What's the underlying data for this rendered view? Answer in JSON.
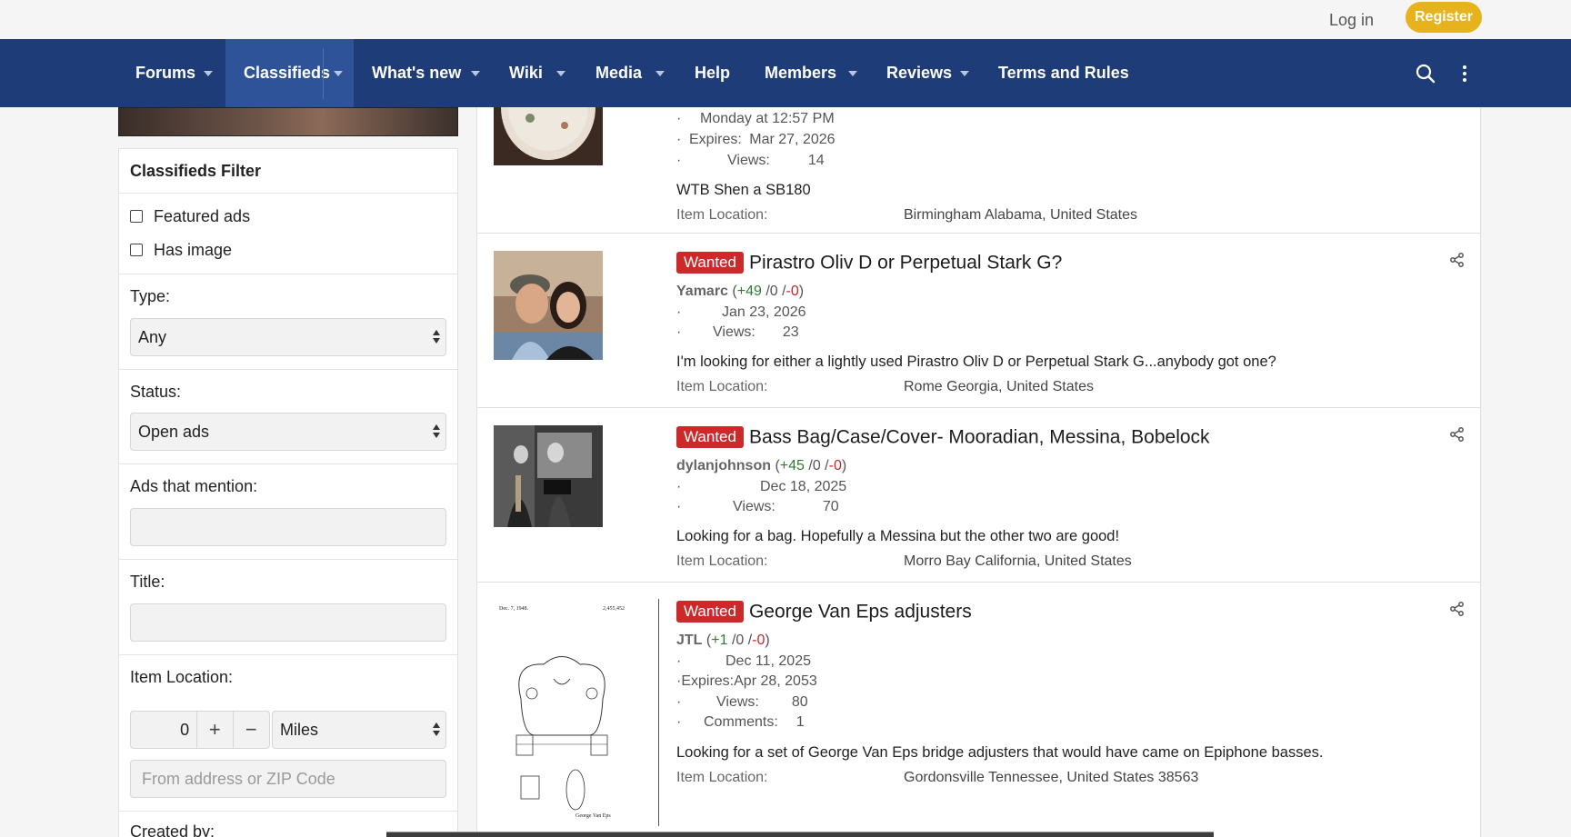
{
  "header": {
    "login": "Log in",
    "register": "Register"
  },
  "nav": {
    "items": [
      {
        "label": "Forums"
      },
      {
        "label": "Classifieds"
      },
      {
        "label": "What's new"
      },
      {
        "label": "Wiki"
      },
      {
        "label": "Media"
      },
      {
        "label": "Help"
      },
      {
        "label": "Members"
      },
      {
        "label": "Reviews"
      },
      {
        "label": "Terms and Rules"
      }
    ],
    "active": "Classifieds",
    "icons": [
      "search-icon",
      "more-vertical-icon"
    ]
  },
  "filter": {
    "title": "Classifieds Filter",
    "featured": "Featured ads",
    "has_image": "Has image",
    "type_label": "Type:",
    "type_value": "Any",
    "status_label": "Status:",
    "status_value": "Open ads",
    "mention_label": "Ads that mention:",
    "title_label": "Title:",
    "location_label": "Item Location:",
    "distance_value": "0",
    "plus": "+",
    "minus": "−",
    "unit_value": "Miles",
    "address_placeholder": "From address or ZIP Code",
    "created_by_label": "Created by:"
  },
  "listings": [
    {
      "date": "Monday at 12:57 PM",
      "expires_label": "Expires:",
      "expires": "Mar 27, 2026",
      "views_label": "Views:",
      "views": "14",
      "desc": "WTB Shen a SB180",
      "location_label": "Item Location:",
      "location": "Birmingham Alabama, United States"
    },
    {
      "badge": "Wanted",
      "title": "Pirastro Oliv D or Perpetual Stark G?",
      "author": "Yamarc",
      "pos": "+49",
      "neutral": "/0 /",
      "neg": "-0",
      "date": "Jan 23, 2026",
      "views_label": "Views:",
      "views": "23",
      "desc": "I'm looking for either a lightly used Pirastro Oliv D or Perpetual Stark G...anybody got one?",
      "location_label": "Item Location:",
      "location": "Rome Georgia, United States"
    },
    {
      "badge": "Wanted",
      "title": "Bass Bag/Case/Cover- Mooradian, Messina, Bobelock",
      "author": "dylanjohnson",
      "pos": "+45",
      "neutral": "/0 /",
      "neg": "-0",
      "date": "Dec 18, 2025",
      "views_label": "Views:",
      "views": "70",
      "desc": "Looking for a bag. Hopefully a Messina but the other two are good!",
      "location_label": "Item Location:",
      "location": "Morro Bay California, United States"
    },
    {
      "badge": "Wanted",
      "title": "George Van Eps adjusters",
      "author": "JTL",
      "pos": "+1",
      "neutral": "/0 /",
      "neg": "-0",
      "date": "Dec 11, 2025",
      "expires_label": "Expires:",
      "expires": "Apr 28, 2053",
      "views_label": "Views:",
      "views": "80",
      "comments_label": "Comments:",
      "comments": "1",
      "desc": "Looking for a set of George Van Eps bridge adjusters that would have came on Epiphone basses.",
      "location_label": "Item Location:",
      "location": "Gordonsville Tennessee, United States 38563",
      "patent_date": "Dec. 7, 1948.",
      "patent_no": "2,455,452",
      "patent_inventor": "George Van Eps"
    }
  ]
}
